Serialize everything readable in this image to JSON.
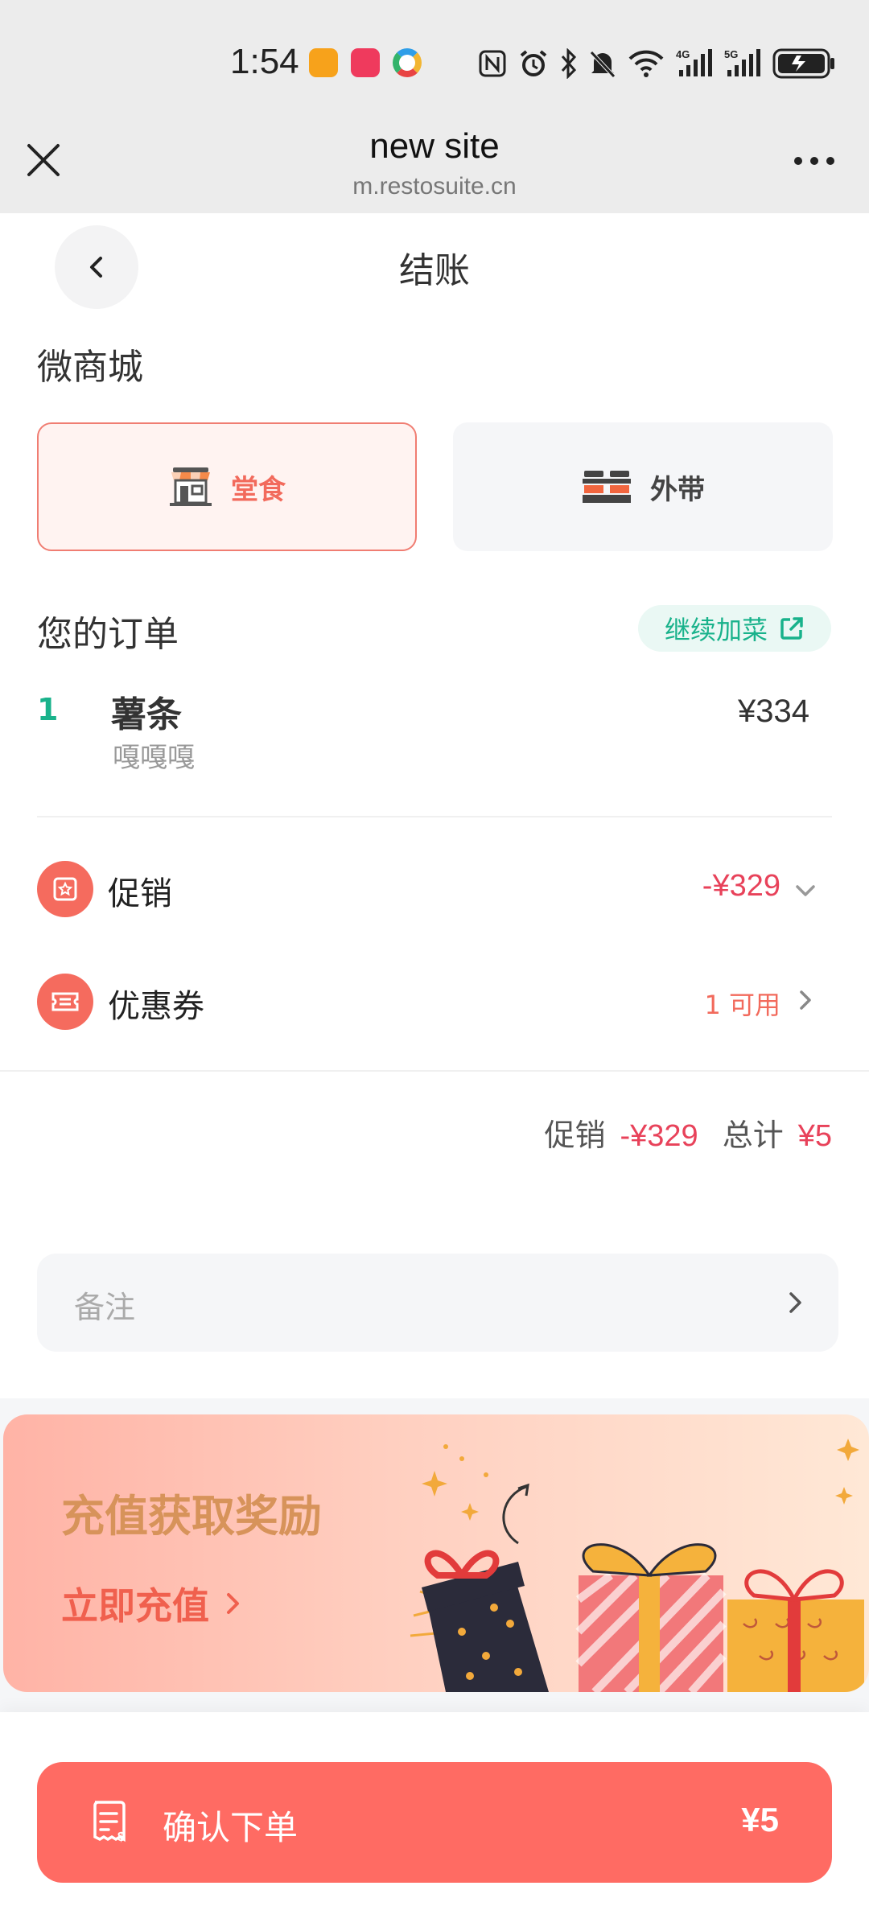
{
  "status_bar": {
    "time": "1:54",
    "app_icons": [
      "reader-app-icon",
      "huawei-appgallery-icon",
      "pinwheel-app-icon"
    ],
    "indicators": [
      "nfc-icon",
      "alarm-icon",
      "bluetooth-icon",
      "silent-icon",
      "wifi-icon",
      "signal-4g-icon",
      "signal-5g-icon",
      "battery-charging-icon"
    ],
    "network_4g": "4G",
    "network_5g": "5G"
  },
  "browser": {
    "title": "new site",
    "url": "m.restosuite.cn"
  },
  "header": {
    "title": "结账"
  },
  "shop": {
    "name": "微商城"
  },
  "dining_modes": [
    {
      "label": "堂食",
      "selected": true
    },
    {
      "label": "外带",
      "selected": false
    }
  ],
  "order": {
    "heading": "您的订单",
    "add_more_label": "继续加菜",
    "items": [
      {
        "qty": "1",
        "name": "薯条",
        "desc": "嘎嘎嘎",
        "price": "¥334"
      }
    ]
  },
  "promotion": {
    "label": "促销",
    "value": "-¥329"
  },
  "coupon": {
    "label": "优惠券",
    "available": "1 可用"
  },
  "summary": {
    "promo_label": "促销",
    "promo_value": "-¥329",
    "total_label": "总计",
    "total_value": "¥5"
  },
  "notes": {
    "placeholder": "备注"
  },
  "banner": {
    "title": "充值获取奖励",
    "cta": "立即充值"
  },
  "bottom": {
    "confirm_label": "确认下单",
    "total": "¥5"
  },
  "colors": {
    "accent": "#ff6b63",
    "green": "#19b28b",
    "price_red": "#e8425a"
  }
}
